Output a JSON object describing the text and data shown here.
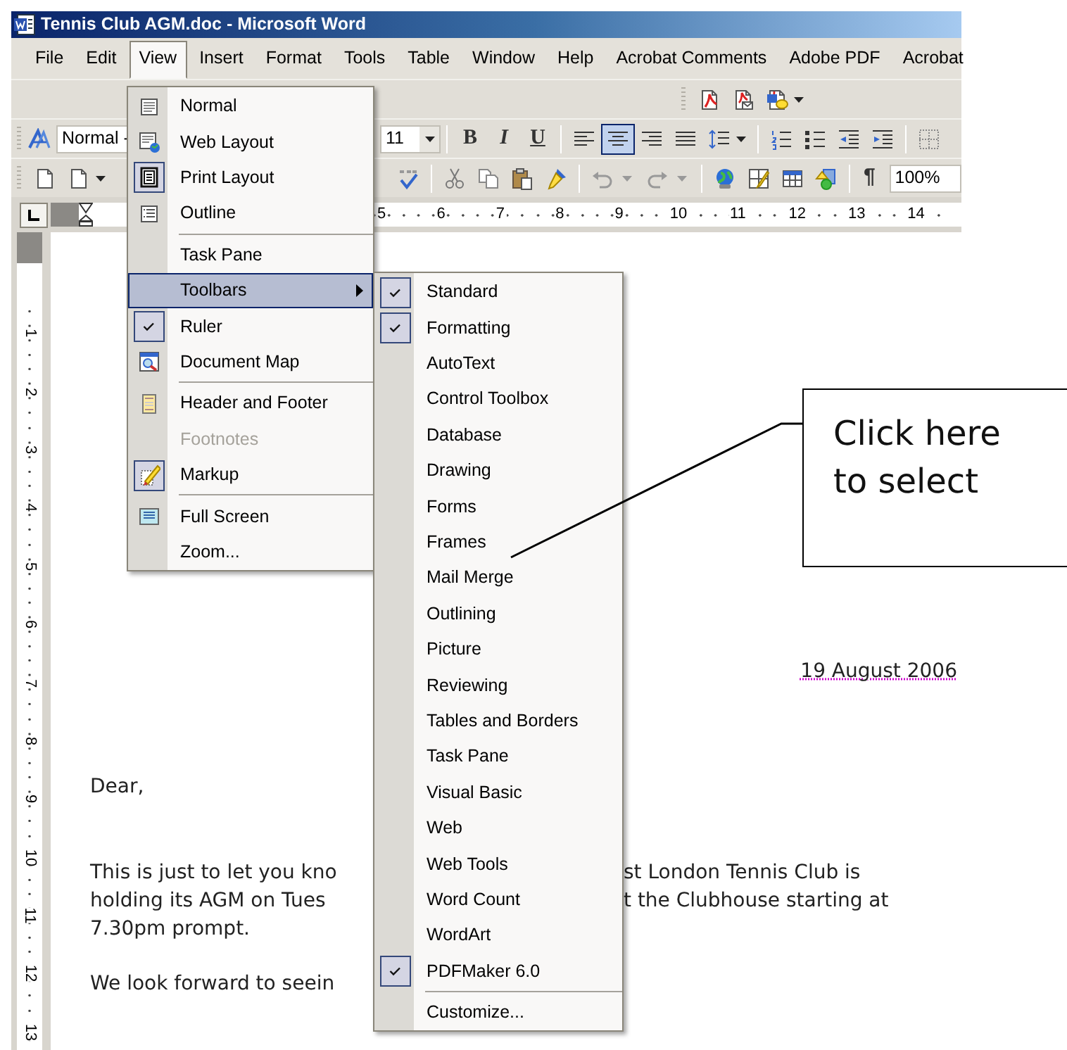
{
  "window": {
    "title": "Tennis Club AGM.doc - Microsoft Word"
  },
  "menubar": [
    {
      "label": "File",
      "selected": false
    },
    {
      "label": "Edit",
      "selected": false
    },
    {
      "label": "View",
      "selected": true
    },
    {
      "label": "Insert",
      "selected": false
    },
    {
      "label": "Format",
      "selected": false
    },
    {
      "label": "Tools",
      "selected": false
    },
    {
      "label": "Table",
      "selected": false
    },
    {
      "label": "Window",
      "selected": false
    },
    {
      "label": "Help",
      "selected": false
    },
    {
      "label": "Acrobat Comments",
      "selected": false
    },
    {
      "label": "Adobe PDF",
      "selected": false
    },
    {
      "label": "Acrobat",
      "selected": false
    }
  ],
  "formatting_toolbar": {
    "style": "Normal -",
    "font_size": "11",
    "bold": "B",
    "italic": "I",
    "underline": "U",
    "alignment_buttons": [
      {
        "selected": false
      },
      {
        "selected": true
      },
      {
        "selected": false
      },
      {
        "selected": false
      }
    ]
  },
  "standard_toolbar": {
    "paragraph_mark": "¶",
    "zoom": "100%"
  },
  "ruler": {
    "numbers": [
      "5",
      "6",
      "7",
      "8",
      "9",
      "10",
      "11",
      "12",
      "13",
      "14"
    ]
  },
  "vertical_ruler": {
    "numbers": [
      "1",
      "2",
      "3",
      "4",
      "5",
      "6",
      "7",
      "8",
      "9",
      "10",
      "11",
      "12",
      "13"
    ]
  },
  "document": {
    "date": "19 August 2006",
    "greeting": "Dear,",
    "paragraphs": [
      {
        "lines": [
          {
            "left": "This is just to let you kno",
            "right": "st London Tennis Club is"
          },
          {
            "left": "holding its AGM on Tues",
            "right": "t the Clubhouse starting at"
          },
          {
            "left": "7.30pm prompt."
          }
        ]
      },
      {
        "lines": [
          {
            "left": "We look forward to seein"
          }
        ]
      }
    ]
  },
  "view_menu": {
    "groups": [
      [
        {
          "label": "Normal",
          "checked": false,
          "selected": false,
          "disabled": false,
          "submenu": false
        },
        {
          "label": "Web Layout",
          "checked": false,
          "selected": false,
          "disabled": false,
          "submenu": false
        },
        {
          "label": "Print Layout",
          "checked": true,
          "selected": false,
          "disabled": false,
          "submenu": false
        },
        {
          "label": "Outline",
          "checked": false,
          "selected": false,
          "disabled": false,
          "submenu": false
        }
      ],
      [
        {
          "label": "Task Pane",
          "checked": false,
          "selected": false,
          "disabled": false,
          "submenu": false
        },
        {
          "label": "Toolbars",
          "checked": false,
          "selected": true,
          "disabled": false,
          "submenu": true
        },
        {
          "label": "Ruler",
          "checked": true,
          "selected": false,
          "disabled": false,
          "submenu": false
        },
        {
          "label": "Document Map",
          "checked": false,
          "selected": false,
          "disabled": false,
          "submenu": false
        }
      ],
      [
        {
          "label": "Header and Footer",
          "checked": false,
          "selected": false,
          "disabled": false,
          "submenu": false
        },
        {
          "label": "Footnotes",
          "checked": false,
          "selected": false,
          "disabled": true,
          "submenu": false
        },
        {
          "label": "Markup",
          "checked": true,
          "selected": false,
          "disabled": false,
          "submenu": false
        }
      ],
      [
        {
          "label": "Full Screen",
          "checked": false,
          "selected": false,
          "disabled": false,
          "submenu": false
        },
        {
          "label": "Zoom...",
          "checked": false,
          "selected": false,
          "disabled": false,
          "submenu": false
        }
      ]
    ]
  },
  "toolbars_submenu": {
    "groups": [
      [
        {
          "label": "Standard",
          "checked": true
        },
        {
          "label": "Formatting",
          "checked": true
        },
        {
          "label": "AutoText",
          "checked": false
        },
        {
          "label": "Control Toolbox",
          "checked": false
        },
        {
          "label": "Database",
          "checked": false
        },
        {
          "label": "Drawing",
          "checked": false
        },
        {
          "label": "Forms",
          "checked": false
        },
        {
          "label": "Frames",
          "checked": false
        },
        {
          "label": "Mail Merge",
          "checked": false
        },
        {
          "label": "Outlining",
          "checked": false
        },
        {
          "label": "Picture",
          "checked": false
        },
        {
          "label": "Reviewing",
          "checked": false
        },
        {
          "label": "Tables and Borders",
          "checked": false
        },
        {
          "label": "Task Pane",
          "checked": false
        },
        {
          "label": "Visual Basic",
          "checked": false
        },
        {
          "label": "Web",
          "checked": false
        },
        {
          "label": "Web Tools",
          "checked": false
        },
        {
          "label": "Word Count",
          "checked": false
        },
        {
          "label": "WordArt",
          "checked": false
        },
        {
          "label": "PDFMaker 6.0",
          "checked": true
        }
      ],
      [
        {
          "label": "Customize...",
          "checked": false
        }
      ]
    ]
  },
  "callout": {
    "text": "Click here to select"
  }
}
